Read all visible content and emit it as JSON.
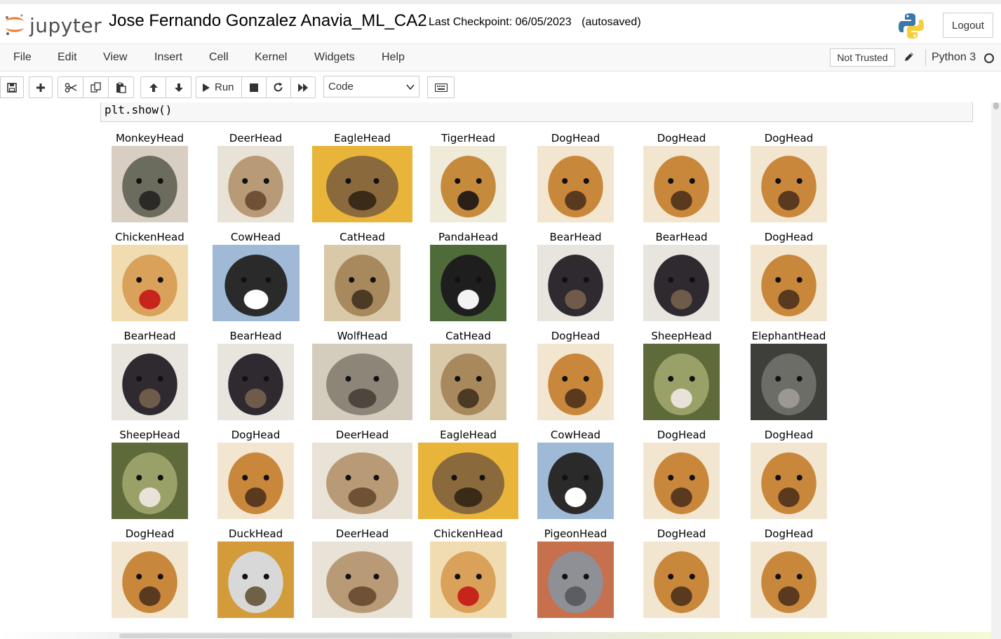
{
  "header": {
    "logo_text": "jupyter",
    "notebook_name": "Jose Fernando Gonzalez Anavia_ML_CA2",
    "checkpoint_label": "Last Checkpoint: 06/05/2023",
    "autosaved": "(autosaved)",
    "logout_label": "Logout"
  },
  "menubar": {
    "items": [
      "File",
      "Edit",
      "View",
      "Insert",
      "Cell",
      "Kernel",
      "Widgets",
      "Help"
    ],
    "trust_label": "Not Trusted",
    "kernel_name": "Python 3"
  },
  "toolbar": {
    "run_label": "Run",
    "cell_type": "Code",
    "icons": [
      "save-icon",
      "plus-icon",
      "scissors-icon",
      "copy-icon",
      "paste-icon",
      "arrow-up-icon",
      "arrow-down-icon",
      "play-icon",
      "stop-icon",
      "restart-icon",
      "fast-forward-icon",
      "keyboard-icon"
    ]
  },
  "cell": {
    "code": "plt.show()"
  },
  "output": {
    "rows": [
      [
        "MonkeyHead",
        "DeerHead",
        "EagleHead",
        "TigerHead",
        "DogHead",
        "DogHead",
        "DogHead"
      ],
      [
        "ChickenHead",
        "CowHead",
        "CatHead",
        "PandaHead",
        "BearHead",
        "BearHead",
        "DogHead"
      ],
      [
        "BearHead",
        "BearHead",
        "WolfHead",
        "CatHead",
        "DogHead",
        "SheepHead",
        "ElephantHead"
      ],
      [
        "SheepHead",
        "DogHead",
        "DeerHead",
        "EagleHead",
        "CowHead",
        "DogHead",
        "DogHead"
      ],
      [
        "DogHead",
        "DuckHead",
        "DeerHead",
        "ChickenHead",
        "PigeonHead",
        "DogHead",
        "DogHead"
      ]
    ]
  },
  "colors": {
    "menubar_bg": "#f8f8f8",
    "border": "#cccccc",
    "code_bg": "#f7f7f7",
    "jupyter_orange": "#f37726"
  }
}
